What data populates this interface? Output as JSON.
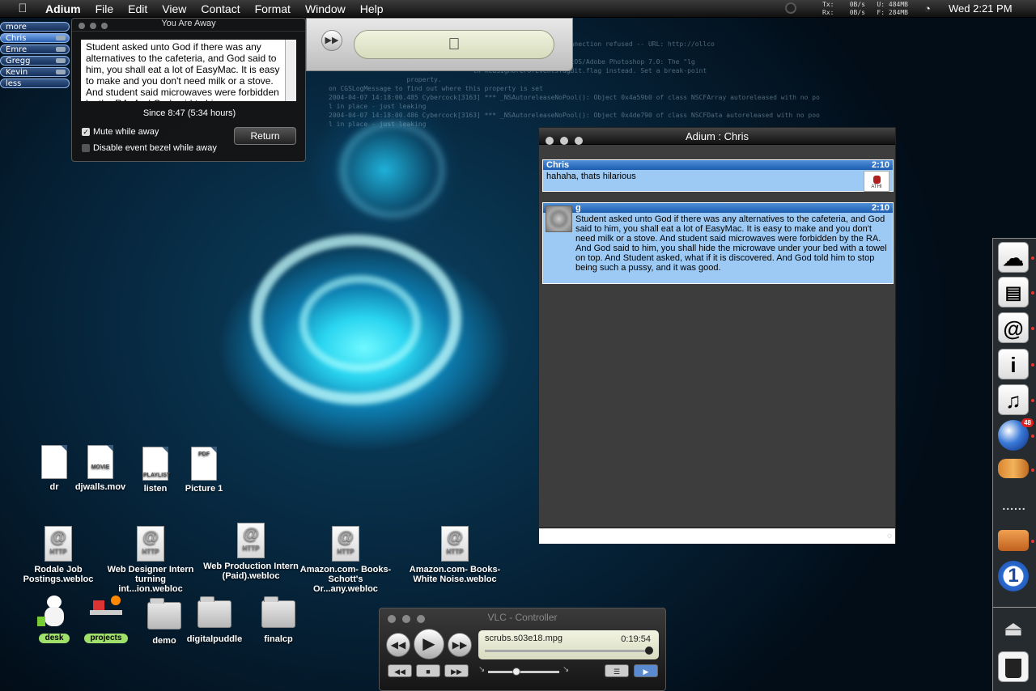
{
  "menubar": {
    "app_name": "Adium",
    "menus": [
      "File",
      "Edit",
      "View",
      "Contact",
      "Format",
      "Window",
      "Help"
    ],
    "net_stats": [
      "Tx:    0B/s   U: 484MB",
      "Rx:    0B/s   F: 284MB"
    ],
    "clock": "Wed 2:21 PM",
    "icons": [
      "apple-icon",
      "disc-icon",
      "wifi-icon"
    ]
  },
  "contact_list": {
    "more_label": "more",
    "contacts": [
      "Chris",
      "Emre",
      "Gregg",
      "Kevin"
    ],
    "less_label": "less"
  },
  "away_window": {
    "title": "You Are Away",
    "message": "Student asked unto God if there was any alternatives to the cafeteria, and God said to him, you shall eat a lot of EasyMac. It is easy to make and you don't need milk or a stove. And student said microwaves were forbidden by the RA. And God said to him",
    "since": "Since 8:47 (5:34 hours)",
    "mute_label": "Mute while away",
    "mute_checked": true,
    "disable_bezel_label": "Disable event bezel while away",
    "disable_bezel_checked": false,
    "return_label": "Return"
  },
  "itunes": {
    "display_icon": "apple-logo-icon"
  },
  "console_lines": [
    "                                                  .s03e18.mpg",
    "                                     -- Domain: POSIX Type: Connection refused -- URL: http://ollco",
    "                                                                                   ",
    "                                     Photoshop 7.0/Contents/MacOS/Adobe Photoshop 7.0: The \"lg",
    "                                     th kCGSIgnoreForEventsTagBit.flag instead. Set a break-point",
    "                    property.",
    "on CGSLogMessage to find out where this property is set",
    "2004-04-07 14:18:00.485 Cybercock[3163] *** _NSAutoreleaseNoPool(): Object 0x4a59b0 of class NSCFArray autoreleased with no po",
    "l in place - just leaking",
    "2004-04-07 14:18:00.486 Cybercock[3163] *** _NSAutoreleaseNoPool(): Object 0x4de790 of class NSCFData autoreleased with no poo",
    "l in place - just leaking"
  ],
  "chat_window": {
    "title": "Adium : Chris",
    "messages": [
      {
        "sender": "Chris",
        "time": "2:10",
        "text": "hahaha, thats hilarious",
        "avatar_label": "ATHI"
      },
      {
        "sender": "g",
        "time": "2:10",
        "text": "Student asked unto God if there was any alternatives to the cafeteria, and God said to him, you shall eat a lot of EasyMac. It is easy to make and you don't need milk or a stove. And student said microwaves were forbidden by the RA. And God said to him, you shall hide the microwave under your bed with a towel on top. And Student asked, what if it is discovered. And God told him to stop being such a pussy, and it was good."
      }
    ],
    "input_value": ""
  },
  "desktop_icons": {
    "row1": [
      {
        "label": "dr",
        "kind": "document"
      },
      {
        "label": "djwalls.mov",
        "kind": "movie",
        "badge": "MOVIE"
      },
      {
        "label": "listen",
        "kind": "playlist",
        "badge": "PLAYLIST"
      },
      {
        "label": "Picture 1",
        "kind": "pdf",
        "badge": "PDF"
      }
    ],
    "row2": [
      {
        "label": "Rodale Job Postings.webloc",
        "badge": "HTTP"
      },
      {
        "label": "Web Designer Intern turning int...ion.webloc",
        "badge": "HTTP"
      },
      {
        "label": "Web Production Intern (Paid).webloc",
        "badge": "HTTP"
      },
      {
        "label": "Amazon.com- Books- Schott's Or...any.webloc",
        "badge": "HTTP"
      },
      {
        "label": "Amazon.com- Books- White Noise.webloc",
        "badge": "HTTP"
      }
    ],
    "row3": [
      {
        "label": "desk",
        "kind": "app"
      },
      {
        "label": "projects",
        "kind": "app"
      },
      {
        "label": "demo",
        "kind": "folder"
      },
      {
        "label": "digitalpuddle",
        "kind": "folder"
      },
      {
        "label": "finalcp",
        "kind": "folder"
      }
    ]
  },
  "vlc": {
    "title": "VLC - Controller",
    "filename": "scrubs.s03e18.mpg",
    "time": "0:19:54",
    "progress": 0.98,
    "volume": 0.2
  },
  "dock": {
    "items": [
      "cloud-icon",
      "document-icon",
      "at-icon",
      "info-icon",
      "music-note-icon",
      "globe-icon",
      "tiger-icon",
      "dots-separator",
      "toast-icon",
      "one-icon",
      "eject-icon",
      "trash-icon"
    ],
    "globe_badge": "48"
  }
}
